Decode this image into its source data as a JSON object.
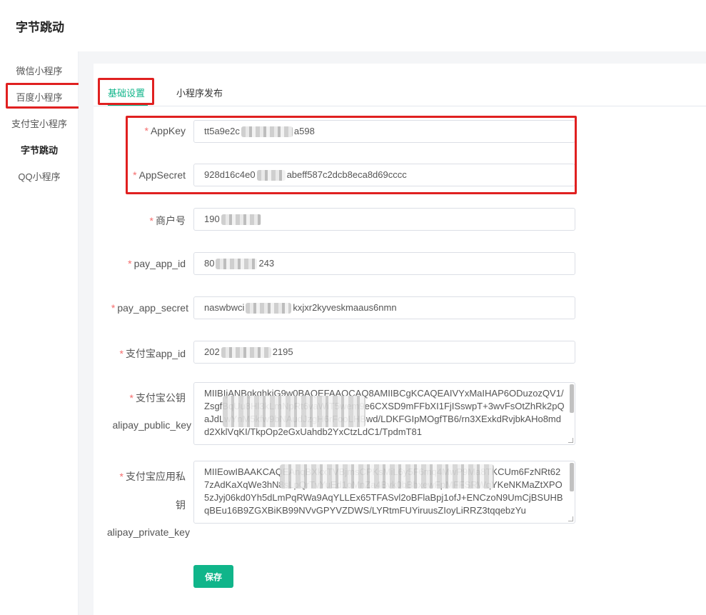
{
  "app": {
    "title": "字节跳动"
  },
  "sidebar": {
    "items": [
      {
        "label": "微信小程序"
      },
      {
        "label": "百度小程序"
      },
      {
        "label": "支付宝小程序"
      },
      {
        "label": "字节跳动"
      },
      {
        "label": "QQ小程序"
      }
    ],
    "active_index": 3
  },
  "tabs": [
    {
      "label": "基础设置"
    },
    {
      "label": "小程序发布"
    }
  ],
  "form": {
    "appkey": {
      "label": "AppKey",
      "value_start": "tt5a9e2c",
      "value_end": "a598"
    },
    "appsecret": {
      "label": "AppSecret",
      "value_start": "928d16c4e0",
      "value_end": "abeff587c2dcb8eca8d69cccc"
    },
    "merchant_no": {
      "label": "商户号",
      "value_start": "190",
      "value_end": ""
    },
    "pay_app_id": {
      "label": "pay_app_id",
      "value_start": "80",
      "value_end": "243"
    },
    "pay_app_secret": {
      "label": "pay_app_secret",
      "value_start": "naswbwci",
      "value_end": "kxjxr2kyveskmaaus6nmn"
    },
    "alipay_app_id": {
      "label": "支付宝app_id",
      "value_start": "202",
      "value_end": "2195"
    },
    "alipay_public_key": {
      "label_line1": "支付宝公钥",
      "label_line2": "alipay_public_key",
      "text": "MIIBIjANBgkqhkiG9w0BAQEFAAOCAQ8AMIIBCgKCAQEAIVYxMaIHAP6ODuzozQV1/ZsgfBqUu8Hl3kLmNpRt6vaWiT5wem9e6CXSD9mFFbXI1FjISswpT+3wvFsOtZhRk2pQaJdLwYnM5kfw9bNAudJzgH6rFooLHBwd/LDKFGIpMOgfTB6/rn3XExkdRvjbkAHo8mdd2XklVqKI/TkpOp2eGxUahdb2YxCtzLdC1/TpdmT81"
    },
    "alipay_private_key": {
      "label_line1": "支付宝应用私",
      "label_line2": "钥",
      "label_line3": "alipay_private_key",
      "text": "MIIEowIBAAKCAQEAnqBXkxTVBjmsCPKsMiL6y5F6mq4MwP9Ma8TKCUm6FzNRt627zAdKaXqWe3hN8sLpQrTvYuEd1oMnZa4Bvk0bBhxewFpMFFSRWqYKeNKMaZtXPO5zJyj06kd0Yh5dLmPqRWa9AqYLLEx65TFASvl2oBFlaBpj1ofJ+ENCzoN9UmCjBSUHBqBEu16B9ZGXBiKB99NVvGPYVZDWS/LYRtmFUYiruusZIoyLiRRZ3tqqebzYu"
    }
  },
  "buttons": {
    "save": "保存"
  },
  "colors": {
    "accent": "#10b58a",
    "annotation_red": "#e02020",
    "required": "#f56c6c"
  }
}
